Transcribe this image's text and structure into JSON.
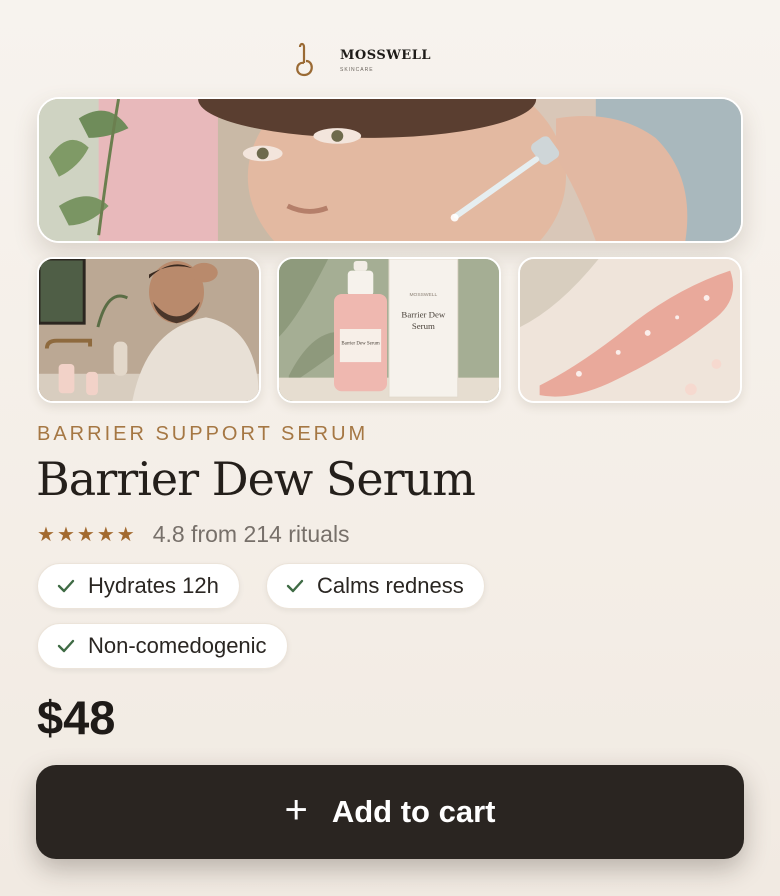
{
  "brand": {
    "name": "MOSSWELL",
    "sub": "SKINCARE"
  },
  "gallery": {
    "hero_alt": "woman-applying-serum-dropper",
    "thumbs": [
      "man-applying-serum",
      "serum-bottle-and-box",
      "serum-texture-swatch"
    ],
    "bottle_label": "Barrier Dew Serum",
    "box_brand": "MOSSWELL",
    "box_label_1": "Barrier Dew",
    "box_label_2": "Serum"
  },
  "product": {
    "eyebrow": "BARRIER SUPPORT SERUM",
    "title": "Barrier Dew Serum",
    "rating_value": 4.8,
    "rating_stars": 5,
    "rating_text": "4.8 from 214 rituals",
    "benefits": [
      "Hydrates 12h",
      "Calms redness",
      "Non-comedogenic"
    ],
    "price": "$48"
  },
  "cart": {
    "label": "Add to cart",
    "icon": "plus-icon"
  },
  "colors": {
    "accent": "#a57743",
    "star": "#a36a2f",
    "check": "#3f6b45",
    "button": "#2a2521"
  }
}
